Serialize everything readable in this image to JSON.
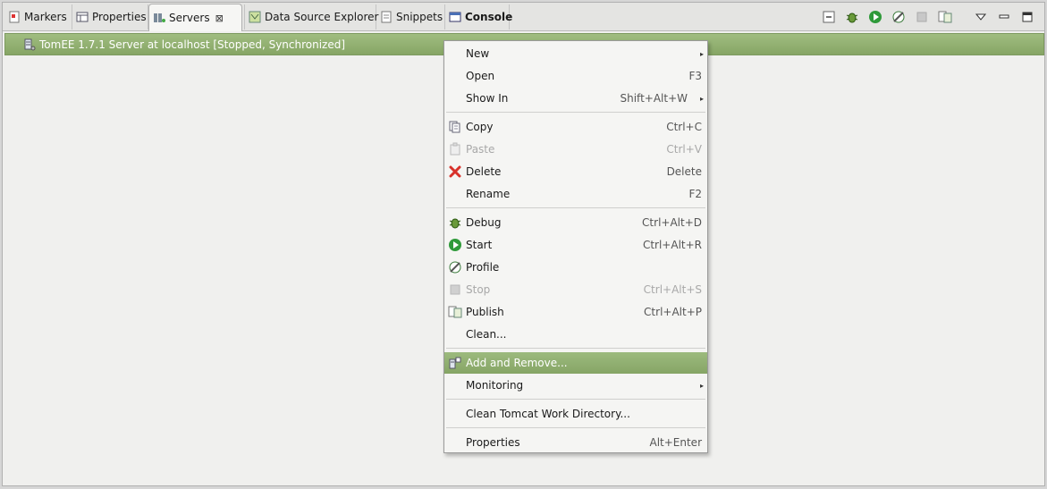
{
  "tabs": [
    {
      "label": "Markers",
      "icon": "markers-icon"
    },
    {
      "label": "Properties",
      "icon": "properties-icon"
    },
    {
      "label": "Servers",
      "icon": "servers-icon",
      "active": true,
      "close_glyph": "⊠"
    },
    {
      "label": "Data Source Explorer",
      "icon": "data-source-icon"
    },
    {
      "label": "Snippets",
      "icon": "snippets-icon"
    },
    {
      "label": "Console",
      "icon": "console-icon",
      "bold": true
    }
  ],
  "toolbar": {
    "icons": [
      "collapse-icon",
      "debug-icon",
      "start-icon",
      "profile-icon",
      "stop-icon",
      "publish-icon",
      "view-menu-icon",
      "minimize-icon",
      "maximize-icon"
    ]
  },
  "server": {
    "label": "TomEE 1.7.1 Server at localhost  [Stopped, Synchronized]",
    "icon": "server-icon"
  },
  "menu": {
    "items": [
      {
        "label": "New",
        "key": "",
        "submenu": true
      },
      {
        "label": "Open",
        "key": "F3"
      },
      {
        "label": "Show In",
        "key": "Shift+Alt+W",
        "submenu": true
      },
      {
        "label": "Copy",
        "key": "Ctrl+C",
        "icon": "copy-icon"
      },
      {
        "label": "Paste",
        "key": "Ctrl+V",
        "icon": "paste-icon",
        "disabled": true
      },
      {
        "label": "Delete",
        "key": "Delete",
        "icon": "delete-icon"
      },
      {
        "label": "Rename",
        "key": "F2"
      },
      {
        "label": "Debug",
        "key": "Ctrl+Alt+D",
        "icon": "debug-icon"
      },
      {
        "label": "Start",
        "key": "Ctrl+Alt+R",
        "icon": "start-icon"
      },
      {
        "label": "Profile",
        "key": "",
        "icon": "profile-icon"
      },
      {
        "label": "Stop",
        "key": "Ctrl+Alt+S",
        "icon": "stop-icon",
        "disabled": true
      },
      {
        "label": "Publish",
        "key": "Ctrl+Alt+P",
        "icon": "publish-icon"
      },
      {
        "label": "Clean...",
        "key": ""
      },
      {
        "label": "Add and Remove...",
        "key": "",
        "icon": "add-remove-icon",
        "highlighted": true
      },
      {
        "label": "Monitoring",
        "key": "",
        "submenu": true
      },
      {
        "label": "Clean Tomcat Work Directory...",
        "key": ""
      },
      {
        "label": "Properties",
        "key": "Alt+Enter"
      }
    ],
    "submenu_arrow": "▸"
  },
  "colors": {
    "accent": "#8fae6f",
    "tab_bar": "#e4e4e2",
    "background": "#f0f0ee"
  }
}
